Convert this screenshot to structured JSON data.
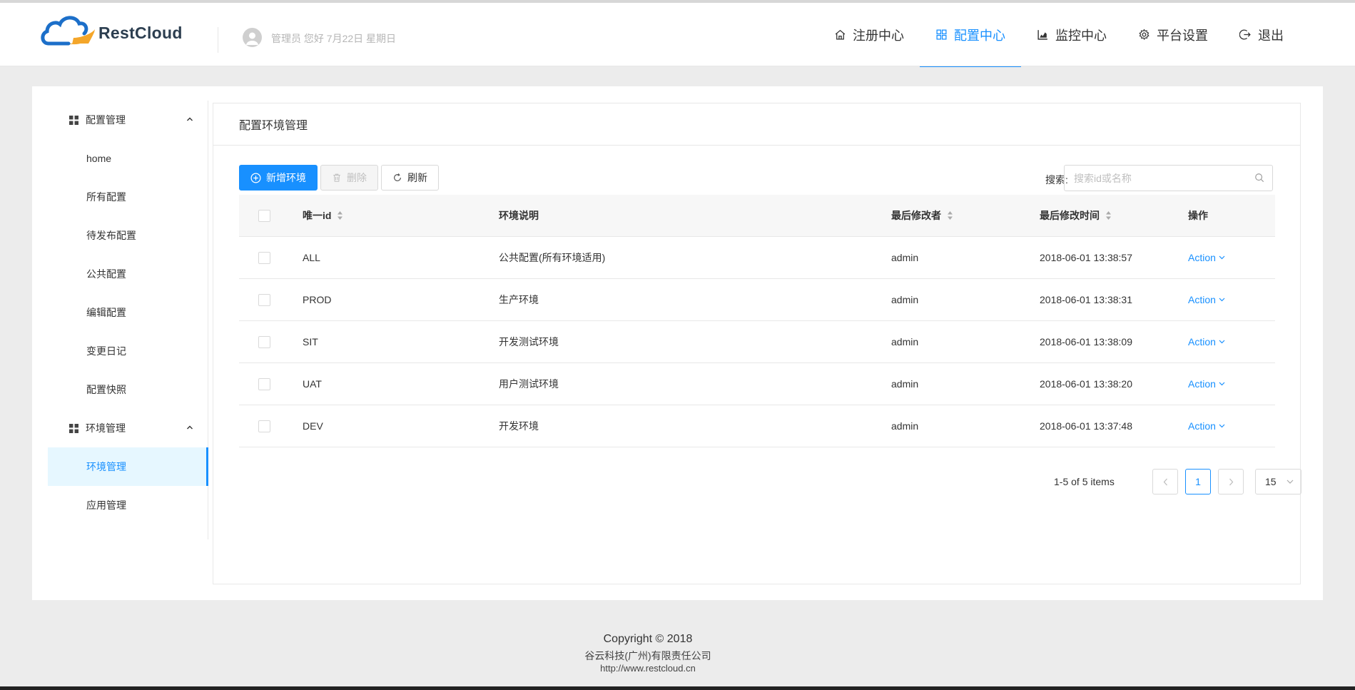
{
  "brand": {
    "name": "RestCloud"
  },
  "header": {
    "greeting": "管理员 您好 7月22日 星期日",
    "nav": [
      {
        "label": "注册中心",
        "icon": "home-icon"
      },
      {
        "label": "配置中心",
        "icon": "grid-icon",
        "active": true
      },
      {
        "label": "监控中心",
        "icon": "chart-icon"
      },
      {
        "label": "平台设置",
        "icon": "gear-icon"
      },
      {
        "label": "退出",
        "icon": "logout-icon"
      }
    ]
  },
  "sidebar": {
    "groups": [
      {
        "label": "配置管理",
        "items": [
          {
            "label": "home"
          },
          {
            "label": "所有配置"
          },
          {
            "label": "待发布配置"
          },
          {
            "label": "公共配置"
          },
          {
            "label": "编辑配置"
          },
          {
            "label": "变更日记"
          },
          {
            "label": "配置快照"
          }
        ]
      },
      {
        "label": "环境管理",
        "items": [
          {
            "label": "环境管理",
            "active": true
          },
          {
            "label": "应用管理"
          }
        ]
      }
    ]
  },
  "panel": {
    "title": "配置环境管理",
    "toolbar": {
      "add_label": "新增环境",
      "delete_label": "删除",
      "refresh_label": "刷新"
    },
    "search": {
      "label": "搜索:",
      "placeholder": "搜索id或名称"
    },
    "table": {
      "columns": [
        "唯一id",
        "环境说明",
        "最后修改者",
        "最后修改时间",
        "操作"
      ],
      "rows": [
        {
          "id": "ALL",
          "desc": "公共配置(所有环境适用)",
          "modifier": "admin",
          "time": "2018-06-01 13:38:57",
          "action": "Action"
        },
        {
          "id": "PROD",
          "desc": "生产环境",
          "modifier": "admin",
          "time": "2018-06-01 13:38:31",
          "action": "Action"
        },
        {
          "id": "SIT",
          "desc": "开发测试环境",
          "modifier": "admin",
          "time": "2018-06-01 13:38:09",
          "action": "Action"
        },
        {
          "id": "UAT",
          "desc": "用户测试环境",
          "modifier": "admin",
          "time": "2018-06-01 13:38:20",
          "action": "Action"
        },
        {
          "id": "DEV",
          "desc": "开发环境",
          "modifier": "admin",
          "time": "2018-06-01 13:37:48",
          "action": "Action"
        }
      ]
    },
    "pagination": {
      "total_text": "1-5 of 5 items",
      "current_page": "1",
      "page_size": "15"
    }
  },
  "footer": {
    "copyright": "Copyright © 2018",
    "company": "谷云科技(广州)有限责任公司",
    "url": "http://www.restcloud.cn"
  },
  "colors": {
    "accent": "#1890ff",
    "logo_blue": "#1c6fc9",
    "logo_orange": "#f4a62a"
  }
}
